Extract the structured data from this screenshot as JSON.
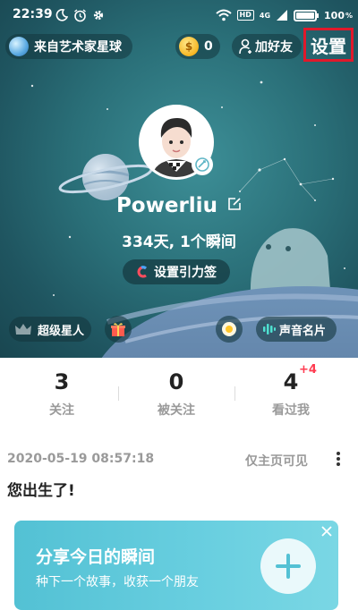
{
  "status_bar": {
    "time": "22:39",
    "hd": "HD",
    "network": "4G",
    "battery": "100"
  },
  "header": {
    "planet_label": "来自艺术家星球",
    "coins": "0",
    "add_friend_label": "加好友",
    "settings_label": "设置"
  },
  "profile": {
    "nickname": "Powerliu",
    "days_summary": "334天, 1个瞬间",
    "gravity_label": "设置引力签",
    "super_star_label": "超级星人",
    "voice_card_label": "声音名片"
  },
  "stats": [
    {
      "value": "3",
      "label": "关注"
    },
    {
      "value": "0",
      "label": "被关注"
    },
    {
      "value": "4",
      "label": "看过我",
      "badge": "+4"
    }
  ],
  "feed": {
    "date": "2020-05-19 08:57:18",
    "visibility": "仅主页可见",
    "text": "您出生了!"
  },
  "share_card": {
    "title": "分享今日的瞬间",
    "subtitle": "种下一个故事，收获一个朋友"
  },
  "colors": {
    "hero_bg": "#2a6f78",
    "settings_highlight": "#e0192b",
    "badge_red": "#ff3b50",
    "share_card": "#5fc8da"
  },
  "icons": [
    "moon-icon",
    "alarm-icon",
    "gear-icon",
    "wifi-icon",
    "signal-icon",
    "battery-icon",
    "planet-icon",
    "coin-icon",
    "add-person-icon",
    "edit-icon",
    "gravity-icon",
    "crown-icon",
    "gift-icon",
    "egg-icon",
    "voice-icon",
    "more-icon",
    "plus-icon",
    "close-icon"
  ]
}
